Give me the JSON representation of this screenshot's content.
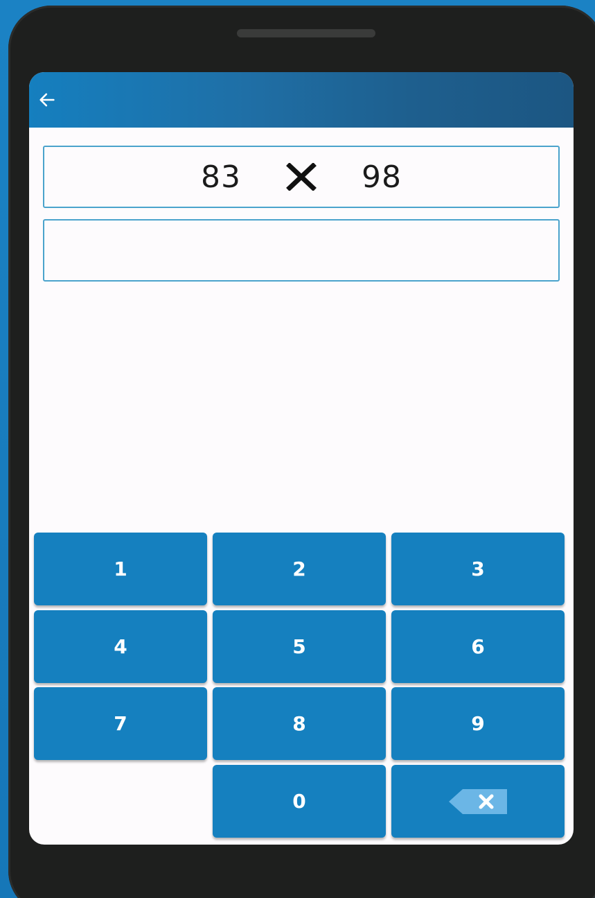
{
  "app_bar": {
    "back_icon": "arrow-left-icon"
  },
  "question": {
    "operand_a": "83",
    "operator_icon": "multiply-icon",
    "operand_b": "98"
  },
  "answer": {
    "value": ""
  },
  "keypad": {
    "keys": [
      "1",
      "2",
      "3",
      "4",
      "5",
      "6",
      "7",
      "8",
      "9",
      "0"
    ],
    "backspace_icon": "backspace-icon"
  },
  "colors": {
    "accent": "#1580bf",
    "outline": "#4aa3cc",
    "frame": "#1e1f1e",
    "background": "#1a7fc1"
  }
}
